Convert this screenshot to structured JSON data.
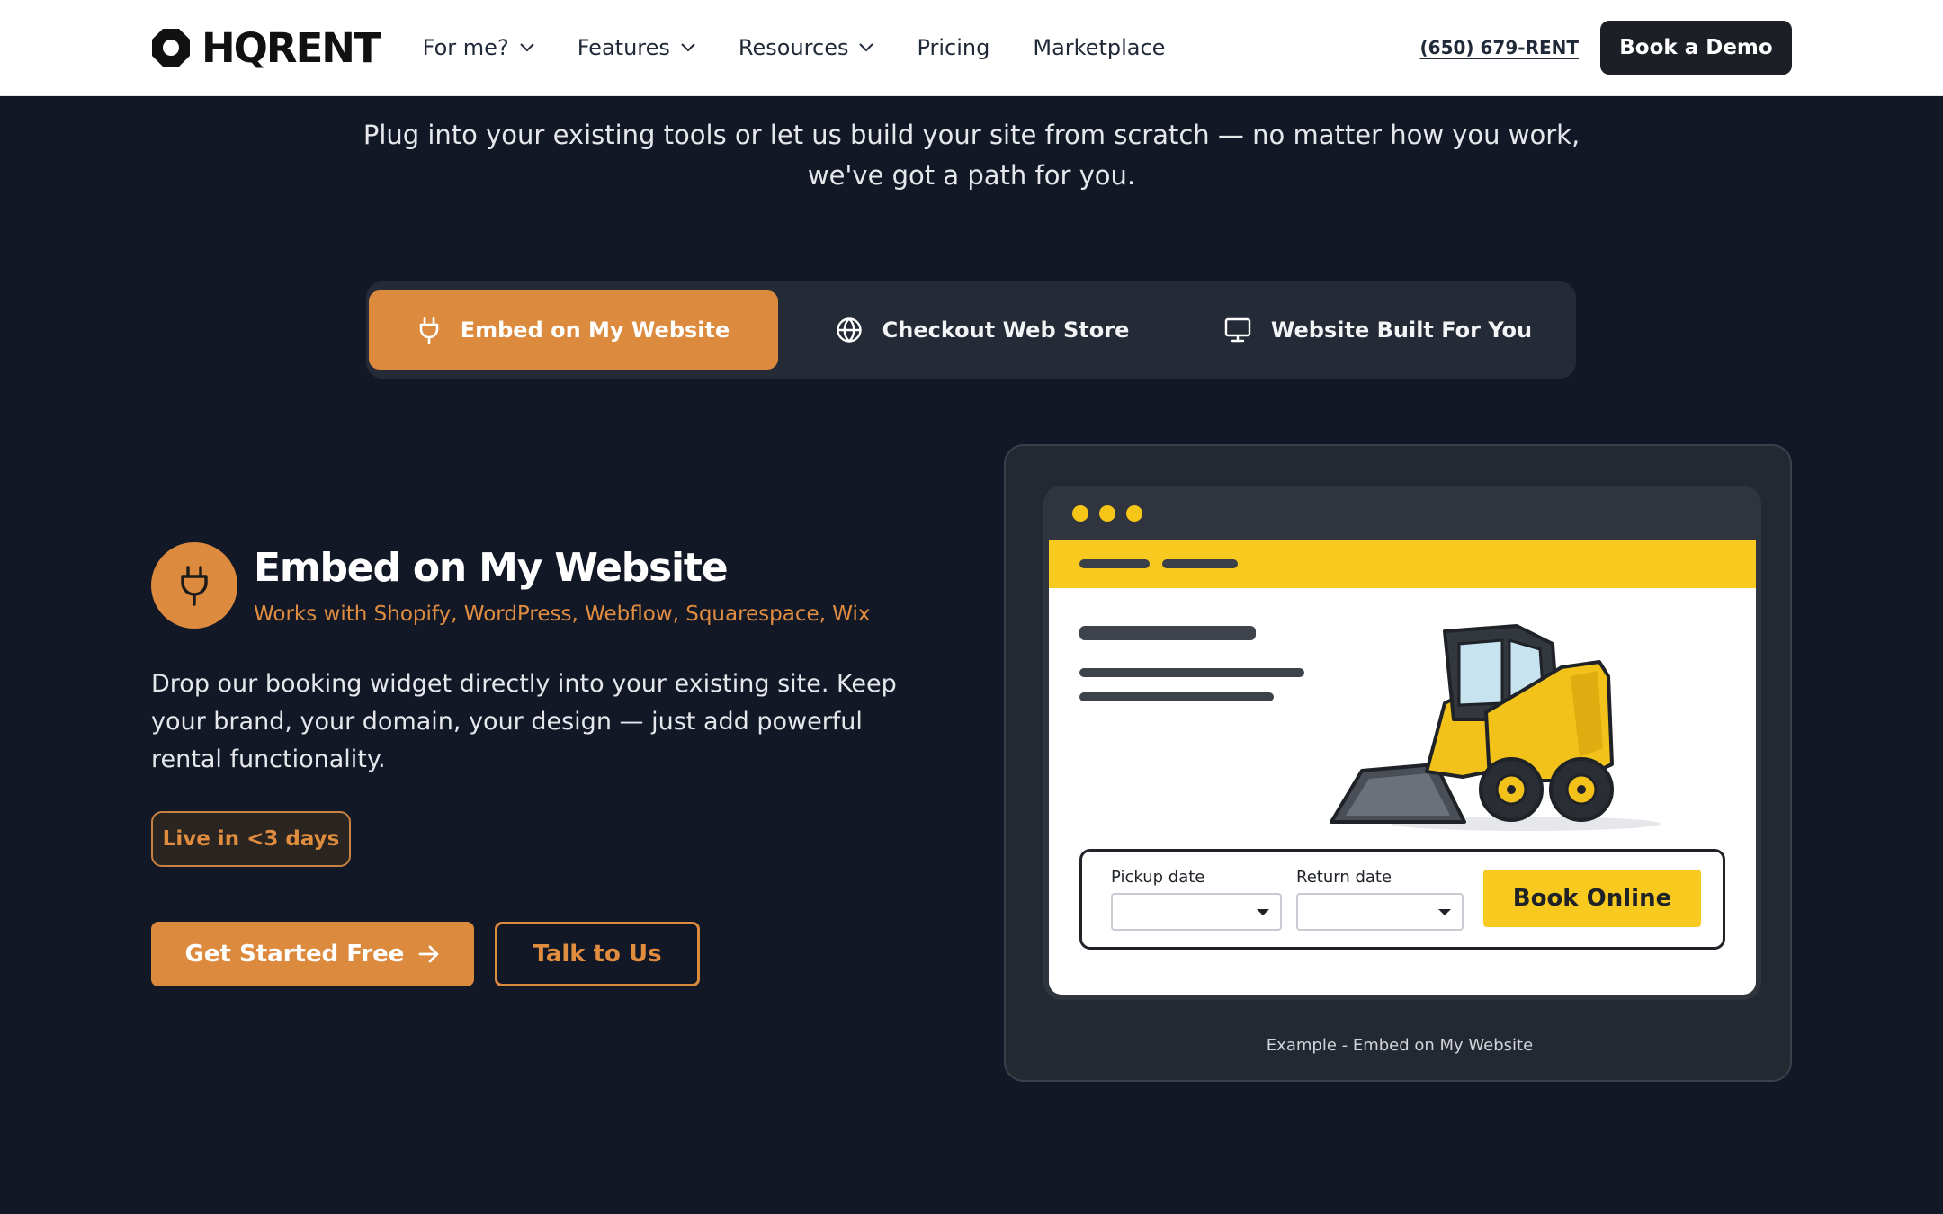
{
  "nav": {
    "logo_text": "HQRENT",
    "links": [
      {
        "label": "For me?",
        "has_dropdown": true
      },
      {
        "label": "Features",
        "has_dropdown": true
      },
      {
        "label": "Resources",
        "has_dropdown": true
      },
      {
        "label": "Pricing",
        "has_dropdown": false
      },
      {
        "label": "Marketplace",
        "has_dropdown": false
      }
    ],
    "phone": "(650) 679-RENT",
    "cta": "Book a Demo"
  },
  "hero": {
    "tagline_line1": "Plug into your existing tools or let us build your site from scratch — no matter how you work,",
    "tagline_line2": "we've got a path for you."
  },
  "tabs": [
    {
      "label": "Embed on My Website",
      "icon": "plug-icon",
      "active": true
    },
    {
      "label": "Checkout Web Store",
      "icon": "globe-icon",
      "active": false
    },
    {
      "label": "Website Built For You",
      "icon": "monitor-icon",
      "active": false
    }
  ],
  "feature": {
    "icon": "plug-icon",
    "title": "Embed on My Website",
    "subtitle": "Works with Shopify, WordPress, Webflow, Squarespace, Wix",
    "description": "Drop our booking widget directly into your existing site. Keep your brand, your domain, your design — just add powerful rental functionality.",
    "badge": "Live in <3 days",
    "primary_cta": "Get Started Free",
    "secondary_cta": "Talk to Us"
  },
  "preview": {
    "pickup_label": "Pickup date",
    "return_label": "Return date",
    "book_button": "Book Online",
    "caption": "Example - Embed on My Website",
    "illustration": "skid-steer-loader"
  },
  "colors": {
    "accent": "#dc8a3e",
    "background": "#131827",
    "widget_yellow": "#f8c91e"
  }
}
